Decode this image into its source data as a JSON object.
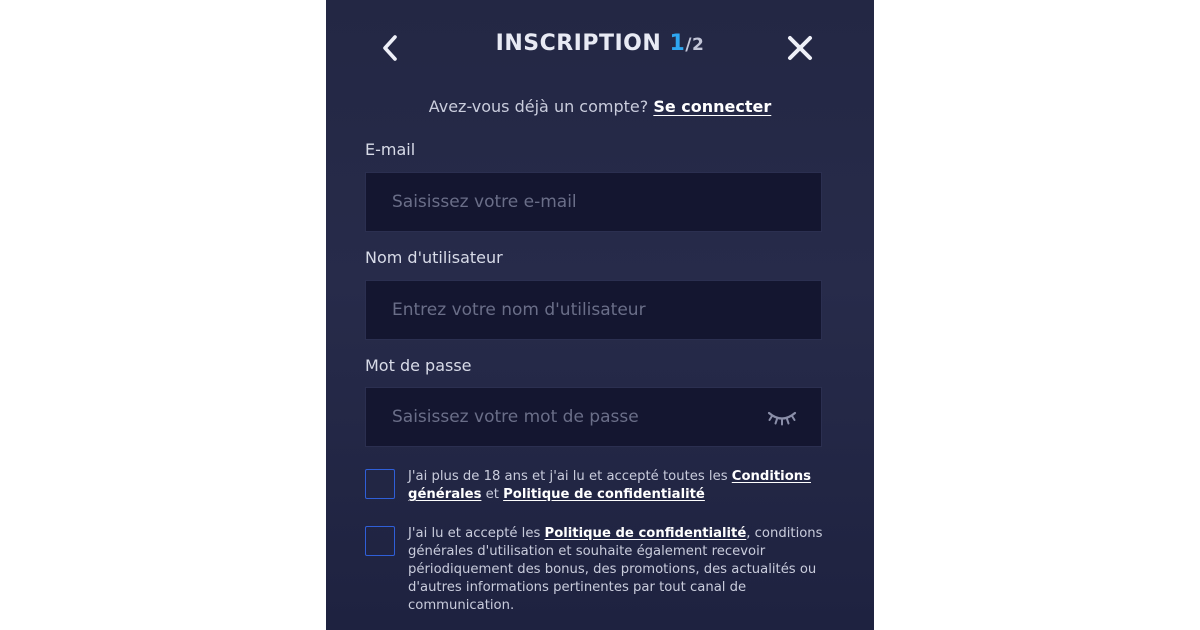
{
  "header": {
    "title": "INSCRIPTION",
    "step_current": "1",
    "step_total": "/2",
    "back_icon": "chevron-left-icon",
    "close_icon": "close-icon"
  },
  "login_prompt": {
    "text": "Avez-vous déjà un compte?",
    "link": "Se connecter"
  },
  "fields": {
    "email": {
      "label": "E-mail",
      "value": "",
      "placeholder": "Saisissez votre e-mail"
    },
    "username": {
      "label": "Nom d'utilisateur",
      "value": "",
      "placeholder": "Entrez votre nom d'utilisateur"
    },
    "password": {
      "label": "Mot de passe",
      "value": "",
      "placeholder": "Saisissez votre mot de passe",
      "toggle_icon": "eye-closed-icon"
    }
  },
  "checkboxes": {
    "age_terms": {
      "checked": false,
      "text_before": "J'ai plus de 18 ans et j'ai lu et accepté toutes les ",
      "link1": "Conditions générales",
      "text_middle": " et ",
      "link2": "Politique de confidentialité"
    },
    "marketing": {
      "checked": false,
      "text_before": "J'ai lu et accepté les ",
      "link1": "Politique de confidentialité",
      "text_after": ", conditions générales d'utilisation et souhaite également recevoir périodiquement des bonus, des promotions, des actualités ou d'autres informations pertinentes par tout canal de communication."
    }
  },
  "colors": {
    "accent": "#2ea6f0",
    "checkbox_border": "#2f5fd8",
    "background": "#252946",
    "input_background": "#141630"
  }
}
